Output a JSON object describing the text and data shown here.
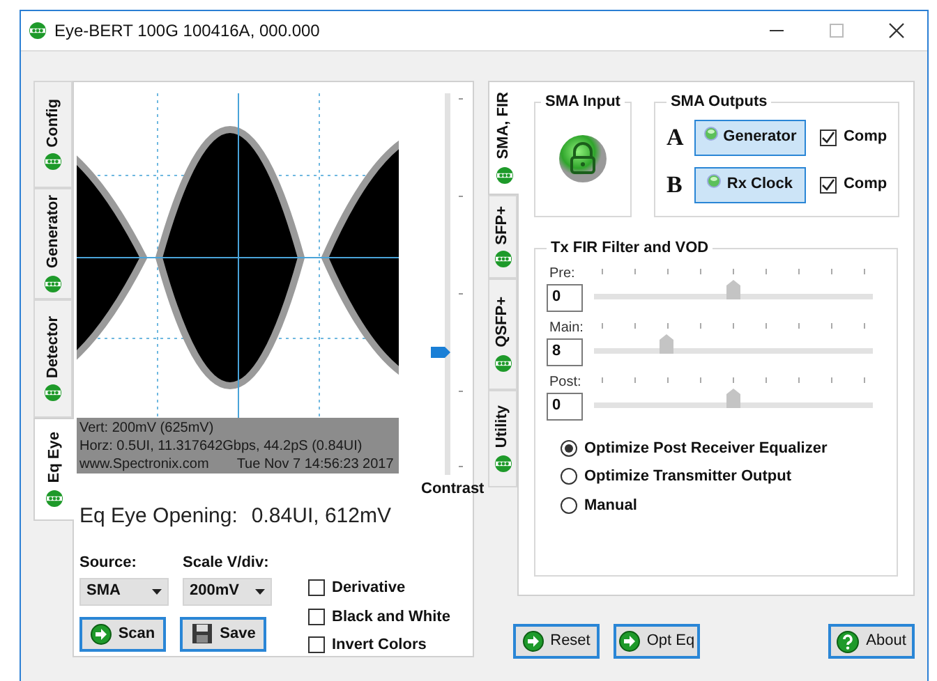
{
  "window": {
    "title": "Eye-BERT 100G 100416A, 000.000"
  },
  "left_tabs": [
    {
      "label": "Config",
      "selected": false
    },
    {
      "label": "Generator",
      "selected": false
    },
    {
      "label": "Detector",
      "selected": false
    },
    {
      "label": "Eq Eye",
      "selected": true
    }
  ],
  "eye_view": {
    "info_lines": [
      "Vert: 200mV (625mV)",
      "Horz: 0.5UI, 11.317642Gbps, 44.2pS (0.84UI)"
    ],
    "site": "www.Spectronix.com",
    "timestamp": "Tue Nov 7 14:56:23 2017"
  },
  "contrast": {
    "label": "Contrast",
    "level": 0.32
  },
  "eye_opening": {
    "label": "Eq Eye Opening:",
    "value": "0.84UI, 612mV"
  },
  "dropdowns": [
    {
      "label": "Source:",
      "value": "SMA"
    },
    {
      "label": "Scale V/div:",
      "value": "200mV"
    }
  ],
  "left_buttons": [
    {
      "label": "Scan",
      "kind": "arrow"
    },
    {
      "label": "Save",
      "kind": "floppy"
    }
  ],
  "checkboxes": [
    {
      "label": "Derivative",
      "checked": false
    },
    {
      "label": "Black and White",
      "checked": false
    },
    {
      "label": "Invert Colors",
      "checked": false
    }
  ],
  "right_tabs": [
    {
      "label": "SMA, FIR",
      "selected": true
    },
    {
      "label": "SFP+",
      "selected": false
    },
    {
      "label": "QSFP+",
      "selected": false
    },
    {
      "label": "Utility",
      "selected": false
    }
  ],
  "sma_input": {
    "title": "SMA Input"
  },
  "sma_outputs": {
    "title": "SMA Outputs",
    "rows": [
      {
        "letter": "A",
        "button": "Generator",
        "comp": "Comp",
        "checked": true
      },
      {
        "letter": "B",
        "button": "Rx Clock",
        "comp": "Comp",
        "checked": true
      }
    ]
  },
  "fir": {
    "title": "Tx FIR Filter and VOD",
    "sliders": [
      {
        "label": "Pre:",
        "value": "0",
        "level": 0.5
      },
      {
        "label": "Main:",
        "value": "8",
        "level": 0.26
      },
      {
        "label": "Post:",
        "value": "0",
        "level": 0.5
      }
    ],
    "options": [
      {
        "label": "Optimize Post Receiver Equalizer",
        "selected": true
      },
      {
        "label": "Optimize Transmitter Output",
        "selected": false
      },
      {
        "label": "Manual",
        "selected": false
      }
    ]
  },
  "bottom_buttons": [
    {
      "label": "Reset",
      "kind": "arrow"
    },
    {
      "label": "Opt Eq",
      "kind": "arrow"
    },
    {
      "label": "About",
      "kind": "help"
    }
  ]
}
